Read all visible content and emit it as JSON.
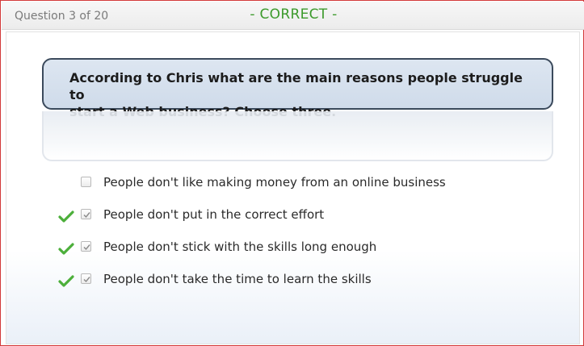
{
  "header": {
    "question_counter": "Question 3 of 20",
    "result": "- CORRECT -",
    "result_color": "#3c9a2c"
  },
  "question": {
    "line1": "According to Chris what are the main reasons people struggle to",
    "line2": "start a Web business? Choose three."
  },
  "answers": [
    {
      "text": "People don't like making money from an online business",
      "checked": false,
      "correct_mark": false
    },
    {
      "text": "People don't put in the correct effort",
      "checked": true,
      "correct_mark": true
    },
    {
      "text": "People don't stick with the skills long enough",
      "checked": true,
      "correct_mark": true
    },
    {
      "text": "People don't take the time to learn the skills",
      "checked": true,
      "correct_mark": true
    }
  ],
  "icons": {
    "correct": "green-check-icon",
    "checkbox_checked": "checkbox-checked-icon"
  }
}
